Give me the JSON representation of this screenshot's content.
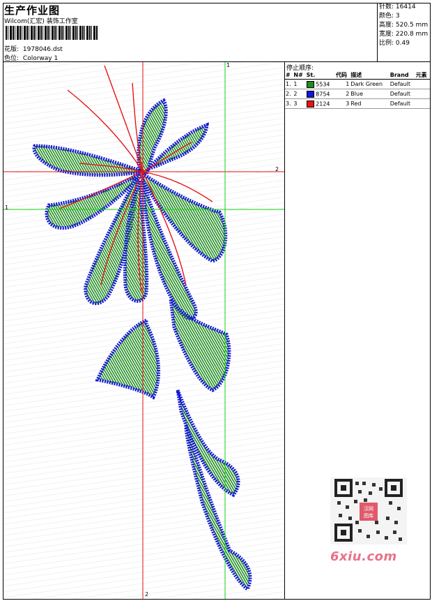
{
  "header": {
    "title": "生产作业图",
    "subtitle": "Wilcom(汇宏) 装饰工作室",
    "design_file_label": "花版:",
    "design_file": "1978046.dst",
    "colorway_label": "色位:",
    "colorway": "Colorway 1"
  },
  "stats": {
    "stitches_label": "针数:",
    "stitches": "16414",
    "colors_label": "颜色:",
    "colors": "3",
    "height_label": "高度:",
    "height": "520.5 mm",
    "width_label": "宽度:",
    "width": "220.8 mm",
    "scale_label": "比例:",
    "scale": "0.49"
  },
  "stop_sequence": {
    "title": "停止顺序:",
    "columns": [
      "#",
      "N#",
      "St.",
      "代码",
      "描述",
      "Brand",
      "元素"
    ],
    "rows": [
      {
        "idx": "1.",
        "n": "1",
        "color": "#1e8c1e",
        "stitches": "5534",
        "code": "1",
        "desc": "Dark Green",
        "brand": "Default"
      },
      {
        "idx": "2.",
        "n": "2",
        "color": "#1414dc",
        "stitches": "8754",
        "code": "2",
        "desc": "Blue",
        "brand": "Default"
      },
      {
        "idx": "3.",
        "n": "3",
        "color": "#e81414",
        "stitches": "2124",
        "code": "3",
        "desc": "Red",
        "brand": "Default"
      }
    ]
  },
  "axes": {
    "red_h_label": "2",
    "red_v_label": "2",
    "green_h_label": "1",
    "green_v_label": "1",
    "red_color": "#e01010",
    "green_color": "#10d010"
  },
  "watermark": {
    "brand_text": "6xiu.com",
    "qr_stamp": "汉网图库"
  }
}
